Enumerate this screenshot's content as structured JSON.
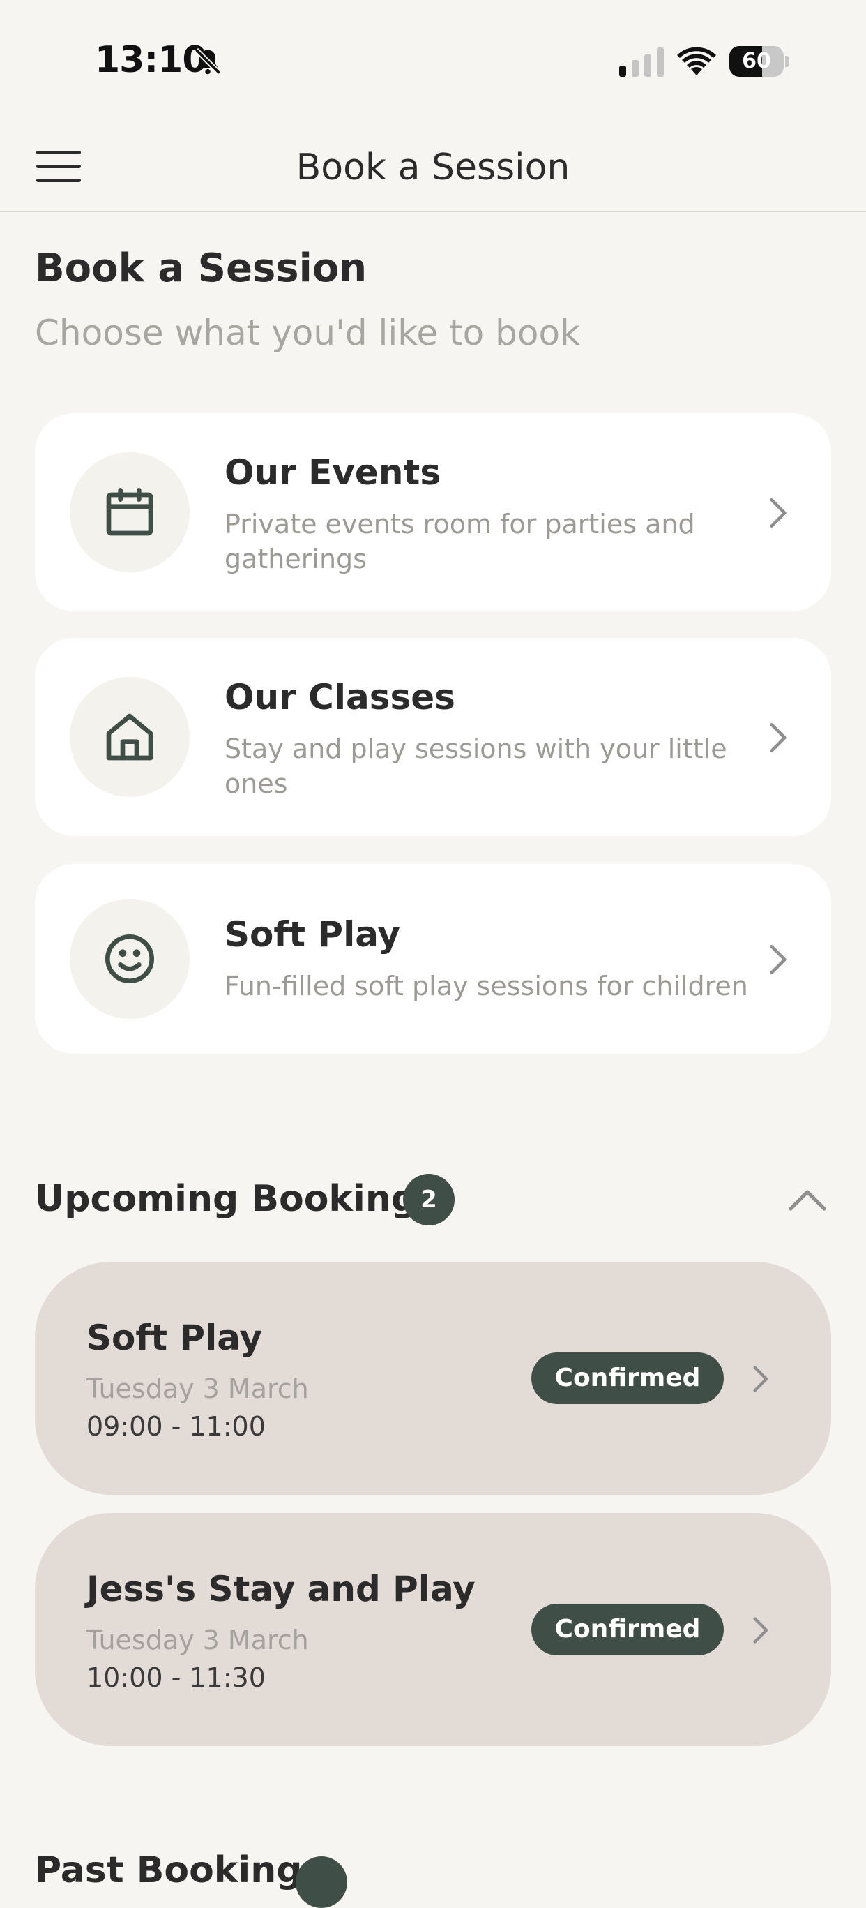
{
  "status_bar": {
    "time": "13:10",
    "battery": "60",
    "battery_level": 0.6,
    "icons": [
      "bell-slash-icon",
      "signal-icon",
      "wifi-icon",
      "battery-icon"
    ]
  },
  "nav": {
    "title": "Book a Session",
    "menu_icon": "hamburger-menu-icon"
  },
  "header": {
    "title": "Book a Session",
    "subtitle": "Choose what you'd like to book"
  },
  "options": [
    {
      "title": "Our Events",
      "description": "Private events room for parties and gatherings",
      "icon": "calendar-icon"
    },
    {
      "title": "Our Classes",
      "description": "Stay and play sessions with your little ones",
      "icon": "home-icon"
    },
    {
      "title": "Soft Play",
      "description": "Fun-filled soft play sessions for children",
      "icon": "smiley-icon"
    }
  ],
  "upcoming": {
    "title": "Upcoming Bookings",
    "count": "2",
    "bookings": [
      {
        "title": "Soft Play",
        "date": "Tuesday 3 March",
        "time": "09:00 - 11:00",
        "status": "Confirmed"
      },
      {
        "title": "Jess's Stay and Play",
        "date": "Tuesday 3 March",
        "time": "10:00 - 11:30",
        "status": "Confirmed"
      }
    ]
  },
  "past": {
    "title": "Past Bookings"
  },
  "colors": {
    "background": "#f6f5f1",
    "accent": "#3f4f47",
    "booking_card": "#e3dbd6",
    "card": "#ffffff",
    "muted_text": "#9b9a95"
  }
}
